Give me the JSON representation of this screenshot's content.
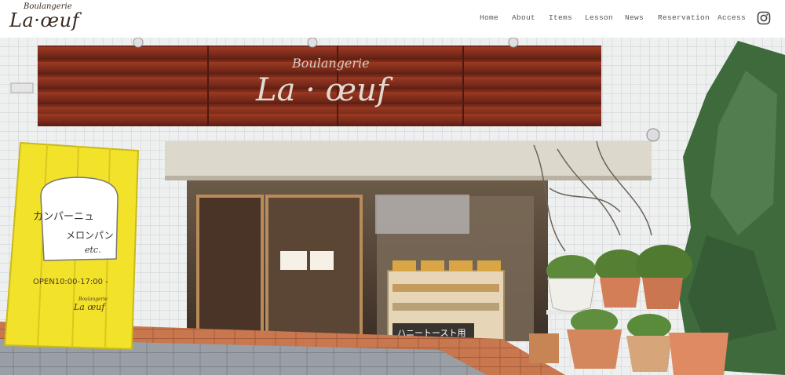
{
  "header": {
    "logo_small": "Boulangerie",
    "logo_main": "La·œuf",
    "nav": [
      {
        "label": "Home"
      },
      {
        "label": "About"
      },
      {
        "label": "Items"
      },
      {
        "label": "Lesson"
      },
      {
        "label": "News"
      },
      {
        "label": "Reservation"
      },
      {
        "label": "Access"
      }
    ],
    "social_icon": "instagram-icon"
  },
  "hero": {
    "shop_sign_small": "Boulangerie",
    "shop_sign_main": "La · œuf",
    "board_line1": "カンパーニュ",
    "board_line2": "メロンパン",
    "board_line3": "etc.",
    "board_hours": "OPEN10:00-17:00 -",
    "board_brand_small": "Boulangerie",
    "board_brand": "La œuf",
    "shelf_label": "ハニートースト用",
    "colors": {
      "wood_sign": "#7a2a1a",
      "yellow_board": "#f3e22a",
      "brick_path": "#c8774e",
      "tile_wall": "#eef0f0",
      "tree": "#3e6a3c"
    }
  }
}
